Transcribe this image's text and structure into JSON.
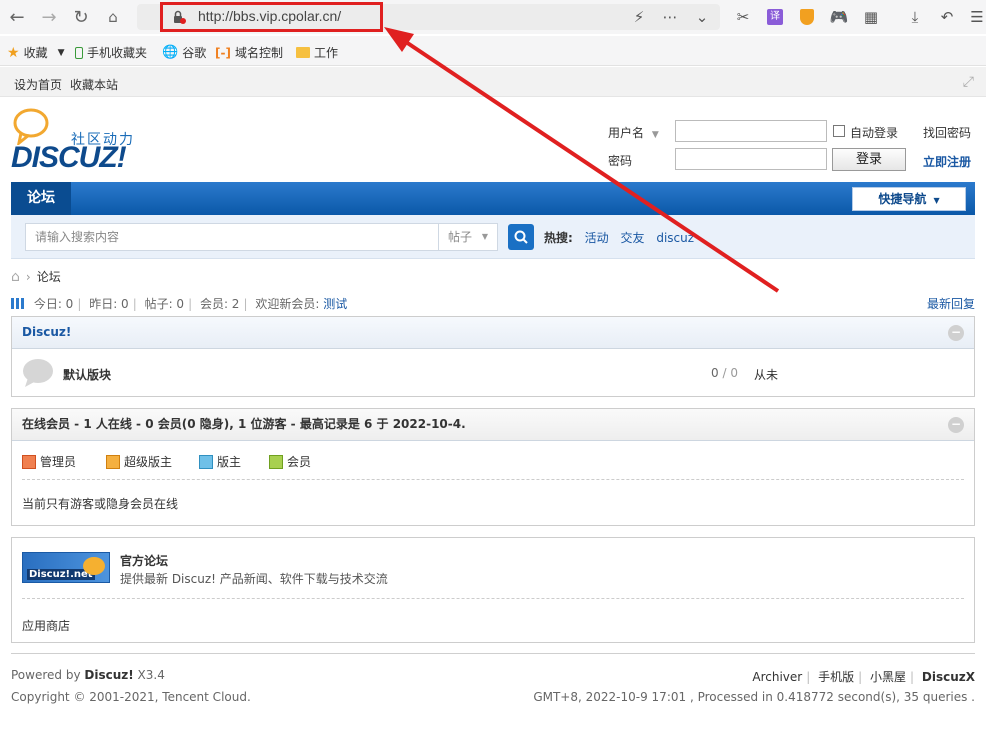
{
  "browser": {
    "url": "http://bbs.vip.cpolar.cn/",
    "bookmarks": [
      "收藏",
      "手机收藏夹",
      "谷歌",
      "域名控制",
      "工作"
    ]
  },
  "topbar": {
    "set_home": "设为首页",
    "bookmark_site": "收藏本站"
  },
  "logo": {
    "text": "DISCUZ!",
    "sub": "社区动力"
  },
  "login": {
    "username_label": "用户名",
    "password_label": "密码",
    "auto_login": "自动登录",
    "find_password": "找回密码",
    "login_button": "登录",
    "register": "立即注册"
  },
  "nav": {
    "forum": "论坛",
    "quick_nav": "快捷导航"
  },
  "search": {
    "placeholder": "请输入搜索内容",
    "type": "帖子",
    "hot_label": "热搜:",
    "hot_items": [
      "活动",
      "交友",
      "discuz"
    ]
  },
  "breadcrumb": {
    "current": "论坛"
  },
  "stats": {
    "today": "今日: 0",
    "yesterday": "昨日: 0",
    "posts": "帖子: 0",
    "members": "会员: 2",
    "welcome": "欢迎新会员:",
    "new_member": "测试",
    "latest_reply": "最新回复"
  },
  "forum_box": {
    "title": "Discuz!",
    "board_name": "默认版块",
    "counts_a": "0",
    "counts_b": "0",
    "last_post": "从未"
  },
  "online_box": {
    "title": "在线会员 - 1 人在线 - 0 会员(0 隐身), 1 位游客 - 最高记录是 6 于 2022-10-4.",
    "legend": [
      "管理员",
      "超级版主",
      "版主",
      "会员"
    ],
    "message": "当前只有游客或隐身会员在线"
  },
  "links_box": {
    "logo_text": "Discuz!.net",
    "official_title": "官方论坛",
    "official_desc": "提供最新 Discuz! 产品新闻、软件下载与技术交流",
    "app_store": "应用商店"
  },
  "footer": {
    "powered_prefix": "Powered by ",
    "powered_brand": "Discuz!",
    "powered_version": " X3.4",
    "copyright": "Copyright © 2001-2021, Tencent Cloud.",
    "links": [
      "Archiver",
      "手机版",
      "小黑屋",
      "DiscuzX"
    ],
    "processed": "GMT+8, 2022-10-9 17:01 , Processed in 0.418772 second(s), 35 queries ."
  },
  "colors": {
    "accent": "#0b58a8",
    "annotation": "#e02020",
    "link": "#1a58a3"
  }
}
